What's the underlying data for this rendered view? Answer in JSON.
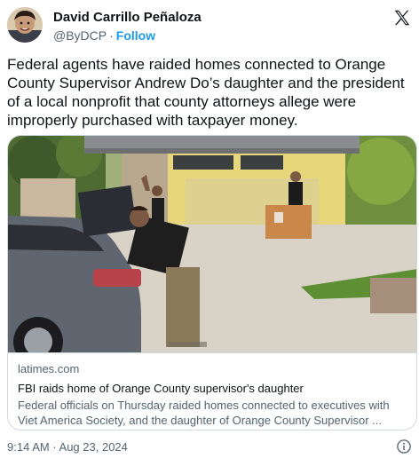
{
  "author": {
    "name": "David Carrillo Peñaloza",
    "handle": "@ByDCP",
    "separator": "·",
    "follow_label": "Follow"
  },
  "brand_icon": "x-logo-icon",
  "tweet": {
    "text": "Federal agents have raided homes connected to Orange County Supervisor Andrew Do’s daughter and the president of a local nonprofit that county attorneys allege were improperly purchased with taxpayer money."
  },
  "link_card": {
    "domain": "latimes.com",
    "title": "FBI raids home of Orange County supervisor's daughter",
    "description": "Federal officials on Thursday raided homes connected to executives with Viet America Society, and the daughter of Orange County Supervisor ..."
  },
  "footer": {
    "timestamp": "9:14 AM · Aug 23, 2024",
    "info_icon": "info-icon"
  },
  "colors": {
    "accent": "#1d9bf0",
    "text_primary": "#0f1419",
    "text_secondary": "#536471",
    "border": "#cfd9de"
  }
}
